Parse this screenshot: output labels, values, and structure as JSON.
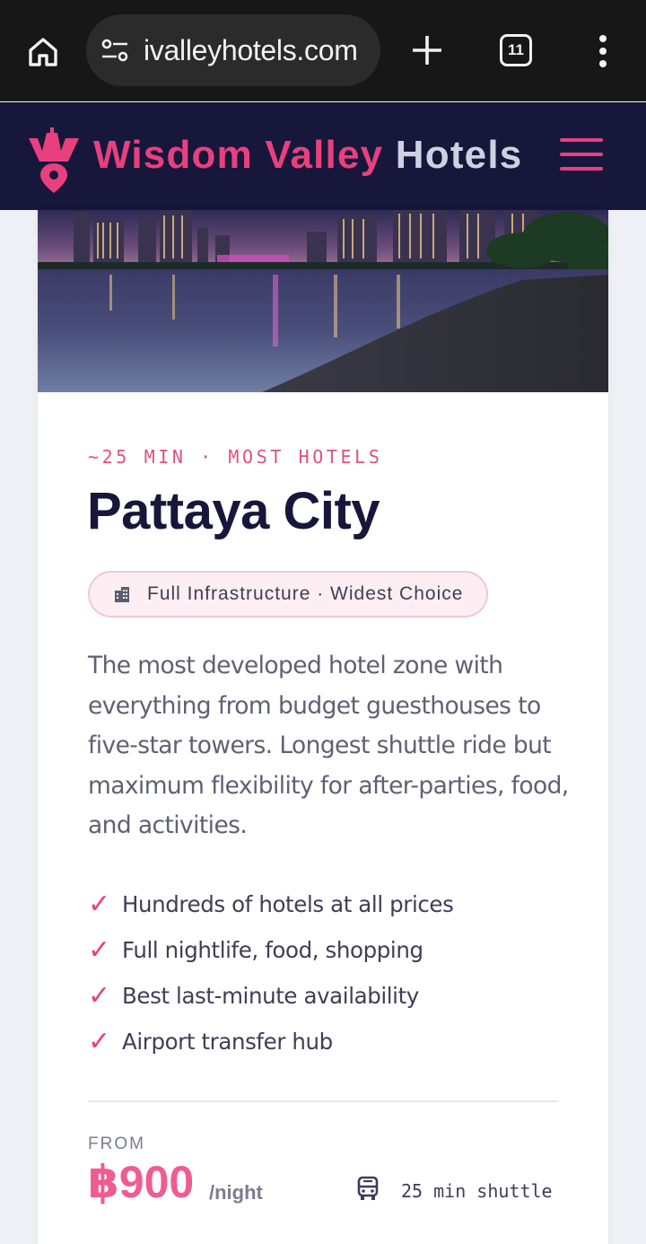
{
  "browser": {
    "url": "ivalleyhotels.com",
    "tab_count": "11"
  },
  "header": {
    "brand_part1": "Wisdom Valley",
    "brand_part2": "Hotels",
    "brand_color": "#e8407e"
  },
  "card": {
    "eyebrow": "~25 MIN · MOST HOTELS",
    "title": "Pattaya City",
    "tag": "Full Infrastructure · Widest Choice",
    "description": "The most developed hotel zone with everything from budget guesthouses to five-star towers. Longest shuttle ride but maximum flexibility for after-parties, food, and activities.",
    "features": [
      "Hundreds of hotels at all prices",
      "Full nightlife, food, shopping",
      "Best last-minute availability",
      "Airport transfer hub"
    ],
    "check_mark": "✓",
    "from_label": "FROM",
    "price": "฿900",
    "price_unit": "/night",
    "shuttle": "25 min shuttle"
  },
  "colors": {
    "accent": "#e8407e",
    "navy": "#16173a"
  }
}
